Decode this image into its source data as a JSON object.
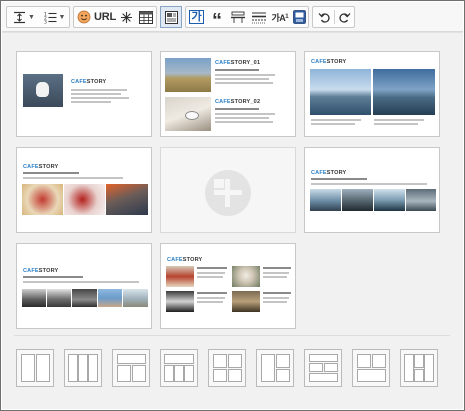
{
  "toolbar": {
    "url_label": "URL",
    "quote_label": "“",
    "text_size_label": "가A",
    "text_size_sup": "1",
    "hangul_label": "가"
  },
  "templates": [
    {
      "title_a": "CAFE",
      "title_b": "STORY"
    },
    {
      "title_a": "CAFE",
      "title_b": "STORY_01",
      "title2_a": "CAFE",
      "title2_b": "STORY_02"
    },
    {
      "title_a": "CAFE",
      "title_b": "STORY"
    },
    {
      "title_a": "CAFE",
      "title_b": "STORY"
    },
    {
      "title_a": "",
      "title_b": ""
    },
    {
      "title_a": "CAFE",
      "title_b": "STORY"
    },
    {
      "title_a": "CAFE",
      "title_b": "STORY"
    },
    {
      "title_a": "CAFE",
      "title_b": "STORY"
    }
  ],
  "colors": {
    "accent": "#2a7ec4",
    "active_button": "#dfe8f3",
    "panel_bg": "#f1f1f1"
  }
}
